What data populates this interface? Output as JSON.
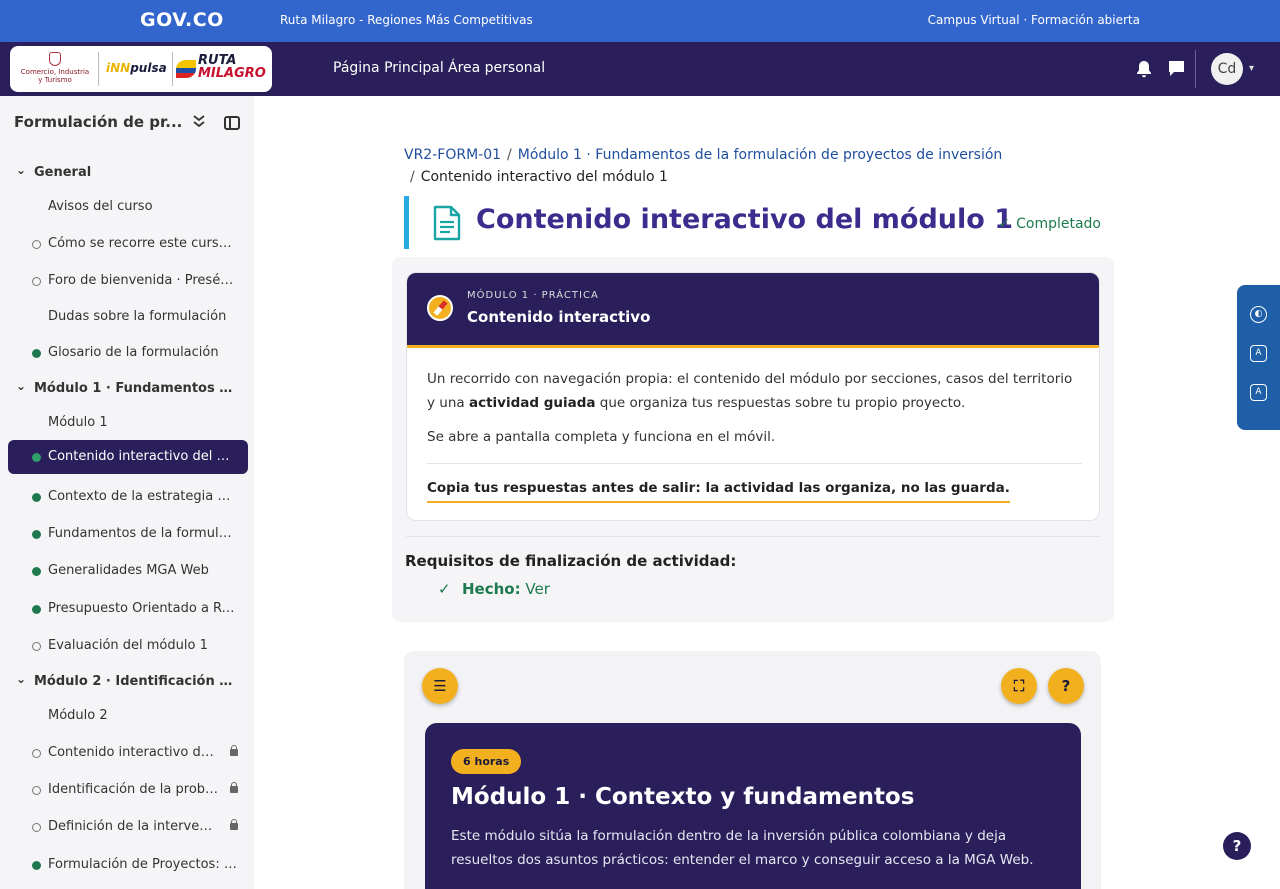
{
  "gov": {
    "logo": "GOV.CO",
    "center_text": "Ruta Milagro - Regiones Más Competitivas",
    "right_text": "Campus Virtual · Formación abierta"
  },
  "brand": {
    "mincit_text": "Comercio, Industria y Turismo",
    "innpulsa_prefix": "iNN",
    "innpulsa_suffix": "pulsa",
    "ruta_line1": "RUTA",
    "ruta_line2": "MILAGRO"
  },
  "nav": {
    "links": [
      "Página Principal",
      "Área personal"
    ],
    "avatar_initials": "Cd",
    "icons": [
      "bell-icon",
      "chat-icon"
    ]
  },
  "sidebar": {
    "title": "Formulación de pr...",
    "sections": [
      {
        "label": "General"
      },
      {
        "label": "Módulo 1 · Fundamentos d..."
      },
      {
        "label": "Módulo 2 · Identificación d..."
      }
    ],
    "items": [
      {
        "label": "Avisos del curso",
        "status": "none"
      },
      {
        "label": "Cómo se recorre este curso ...",
        "status": "open"
      },
      {
        "label": "Foro de bienvenida · Presént...",
        "status": "open"
      },
      {
        "label": "Dudas sobre la formulación",
        "status": "none"
      },
      {
        "label": "Glosario de la formulación",
        "status": "done"
      },
      {
        "label": "Módulo 1",
        "status": "none"
      },
      {
        "label": "Contenido interactivo del mó...",
        "status": "done",
        "active": true
      },
      {
        "label": "Contexto de la estrategia de...",
        "status": "done"
      },
      {
        "label": "Fundamentos de la formulac...",
        "status": "done"
      },
      {
        "label": "Generalidades MGA Web",
        "status": "done"
      },
      {
        "label": "Presupuesto Orientado a Res...",
        "status": "done"
      },
      {
        "label": "Evaluación del módulo 1",
        "status": "open"
      },
      {
        "label": "Módulo 2",
        "status": "none"
      },
      {
        "label": "Contenido interactivo del ...",
        "status": "open",
        "locked": true
      },
      {
        "label": "Identificación de la proble...",
        "status": "open",
        "locked": true
      },
      {
        "label": "Definición de la intervenci...",
        "status": "open",
        "locked": true
      },
      {
        "label": "Formulación de Proyectos: I...",
        "status": "done"
      }
    ]
  },
  "breadcrumb": {
    "course": "VR2-FORM-01",
    "module": "Módulo 1 · Fundamentos de la formulación de proyectos de inversión",
    "current": "Contenido interactivo del módulo 1",
    "separator": "/"
  },
  "page": {
    "title": "Contenido interactivo del módulo 1",
    "status": "Completado"
  },
  "activity": {
    "kicker": "MÓDULO 1 · PRÁCTICA",
    "title": "Contenido interactivo",
    "para1_a": "Un recorrido con navegación propia: el contenido del módulo por secciones, casos del territorio y una ",
    "para1_b": "actividad guiada",
    "para1_c": " que organiza tus respuestas sobre tu propio proyecto.",
    "para2": "Se abre a pantalla completa y funciona en el móvil.",
    "note": "Copia tus respuestas antes de salir: la actividad las organiza, no las guarda."
  },
  "completion": {
    "title": "Requisitos de finalización de actividad:",
    "label": "Hecho:",
    "value": "Ver"
  },
  "viewer": {
    "menu_glyph": "☰",
    "fullscreen_glyph": "⛶",
    "help_glyph": "?",
    "pill": "6 horas",
    "title": "Módulo 1 · Contexto y fundamentos",
    "description": "Este módulo sitúa la formulación dentro de la inversión pública colombiana y deja resueltos dos asuntos prácticos: entender el marco y conseguir acceso a la MGA Web."
  },
  "a11y": {
    "buttons": [
      "contrast-icon",
      "decrease-font-icon",
      "increase-font-icon"
    ]
  },
  "help_button": "?",
  "colors": {
    "gov_blue": "#3366cc",
    "brand_purple": "#2a1f5b",
    "accent_yellow": "#f2b01e",
    "done_green": "#1e7a4e",
    "title_purple": "#3d2c8d",
    "link_blue": "#1f4f9e"
  }
}
